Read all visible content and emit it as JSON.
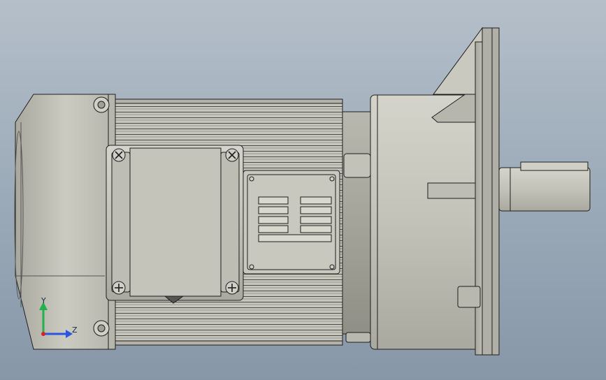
{
  "viewport": {
    "background_top": "#b4bfc9",
    "background_bottom": "#8797a8",
    "model_color": "#c4c4ba",
    "edge_color": "#1e1e1e"
  },
  "triad": {
    "y_label": "Y",
    "z_label": "Z",
    "y_color": "#22b14c",
    "z_color": "#2b55e0",
    "x_color": "#e02020"
  },
  "icons": [
    "gear-motor-model",
    "coordinate-triad-icon"
  ]
}
